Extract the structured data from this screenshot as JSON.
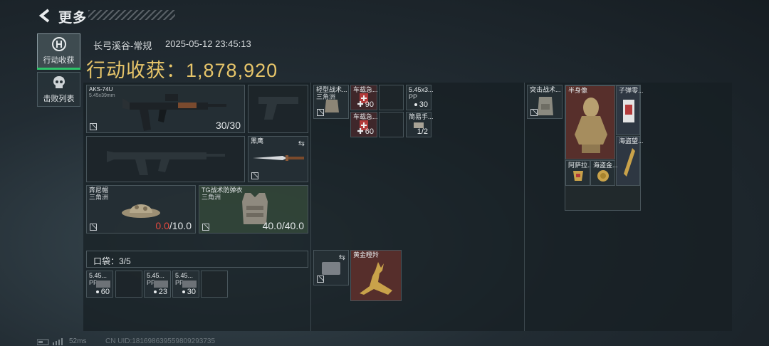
{
  "header": {
    "title": "更多"
  },
  "tabs": [
    {
      "label": "行动收获",
      "icon": "target-icon",
      "active": true
    },
    {
      "label": "击败列表",
      "icon": "skull-icon",
      "active": false
    }
  ],
  "raid": {
    "map": "长弓溪谷-常规",
    "datetime": "2025-05-12 23:45:13",
    "haul_label": "行动收获：",
    "haul_value": "1,878,920"
  },
  "equipment": {
    "primary_weapon": {
      "name": "AKS-74U",
      "ammo_type": "5.45x39mm",
      "ammo": "30/30"
    },
    "melee": {
      "name": "黑鹰"
    },
    "helmet": {
      "name": "奔尼帽",
      "sub": "三角洲",
      "durability_current": "0.0",
      "durability_max": "/10.0"
    },
    "armor": {
      "name": "TG战术防弹衣",
      "sub": "三角洲",
      "durability": "40.0/40.0"
    }
  },
  "pockets": {
    "label": "口袋：3/5",
    "items": [
      {
        "name": "5.45...",
        "sub": "PP",
        "count": "60"
      },
      {
        "name": "5.45...",
        "sub": "PP",
        "count": "23"
      },
      {
        "name": "5.45...",
        "sub": "PP",
        "count": "30"
      }
    ]
  },
  "chest_rig": {
    "items": [
      {
        "name": "轻型战术...",
        "sub": "三角洲"
      },
      {
        "name": "车载急...",
        "count": "90"
      },
      {
        "name": "车载急...",
        "count": "60"
      },
      {
        "name": "5.45x3...",
        "sub": "PP",
        "count": "30"
      },
      {
        "name": "简易手...",
        "count": "1/2"
      }
    ],
    "case": {
      "name": "黄金瞪羚"
    }
  },
  "backpack": {
    "items": [
      {
        "name": "突击战术..."
      },
      {
        "name": "半身像"
      },
      {
        "name": "子弹零..."
      },
      {
        "name": "海盗望..."
      },
      {
        "name": "阿萨拉..."
      },
      {
        "name": "海盗金..."
      }
    ]
  },
  "status": {
    "ping": "52ms",
    "uid": "CN UID:181698639559809293735"
  }
}
